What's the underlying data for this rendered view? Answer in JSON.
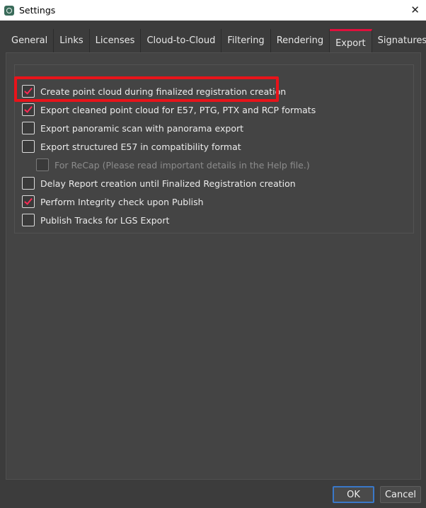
{
  "window": {
    "title": "Settings",
    "close_symbol": "✕"
  },
  "tabs": [
    {
      "label": "General"
    },
    {
      "label": "Links"
    },
    {
      "label": "Licenses"
    },
    {
      "label": "Cloud-to-Cloud"
    },
    {
      "label": "Filtering"
    },
    {
      "label": "Rendering"
    },
    {
      "label": "Export",
      "active": true
    },
    {
      "label": "Signatures"
    }
  ],
  "export": {
    "options": [
      {
        "label": "Create point cloud during finalized registration creation",
        "checked": true,
        "enabled": true
      },
      {
        "label": "Export cleaned point cloud for E57, PTG, PTX and RCP formats",
        "checked": true,
        "enabled": true
      },
      {
        "label": "Export panoramic scan with panorama export",
        "checked": false,
        "enabled": true
      },
      {
        "label": "Export structured E57 in compatibility format",
        "checked": false,
        "enabled": true
      },
      {
        "label": "For ReCap  (Please read important details in the Help file.)",
        "checked": false,
        "enabled": false
      },
      {
        "label": "Delay Report creation until Finalized Registration creation",
        "checked": false,
        "enabled": true
      },
      {
        "label": "Perform Integrity check upon Publish",
        "checked": true,
        "enabled": true
      },
      {
        "label": "Publish Tracks for LGS Export",
        "checked": false,
        "enabled": true
      }
    ]
  },
  "colors": {
    "accent": "#e0103c",
    "check": "#ff2a55",
    "highlight": "#e8131a",
    "ok_border": "#3a78c8"
  },
  "buttons": {
    "ok": "OK",
    "cancel": "Cancel"
  }
}
